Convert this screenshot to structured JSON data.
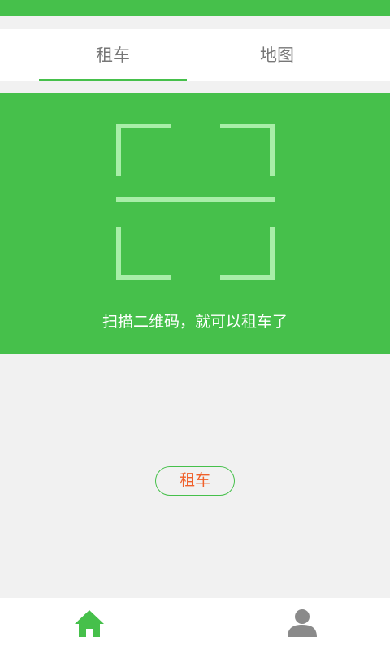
{
  "tabs": [
    {
      "label": "租车",
      "active": true
    },
    {
      "label": "地图",
      "active": false
    }
  ],
  "scan": {
    "caption": "扫描二维码，就可以租车了"
  },
  "actions": {
    "rent_button": "租车"
  },
  "bottom_nav": [
    {
      "icon": "home-icon",
      "active": true
    },
    {
      "icon": "user-icon",
      "active": false
    }
  ],
  "colors": {
    "accent": "#46c04b",
    "scan_frame": "#a8eea8",
    "rent_text": "#f0602a",
    "inactive_icon": "#8a8a8a"
  }
}
